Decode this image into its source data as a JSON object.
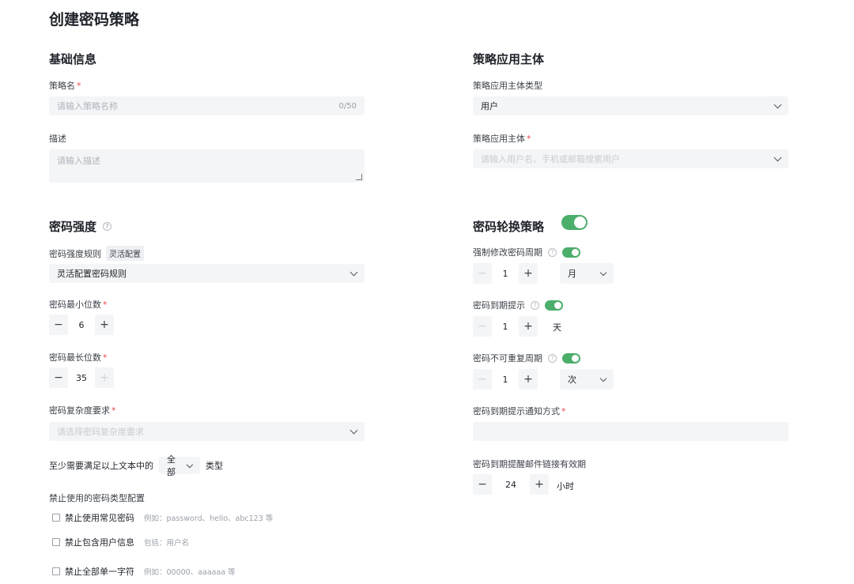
{
  "page": {
    "title": "创建密码策略",
    "breadcrumb_fragment": "……"
  },
  "basic": {
    "title": "基础信息",
    "name_label": "策略名",
    "required_mark": "*",
    "name_placeholder": "请输入策略名称",
    "name_counter": "0/50",
    "desc_label": "描述",
    "desc_placeholder": "请输入描述"
  },
  "subject": {
    "title": "策略应用主体",
    "type_label": "策略应用主体类型",
    "type_value": "用户",
    "subject_label": "策略应用主体",
    "subject_placeholder": "请输入用户名、手机或邮箱搜索用户"
  },
  "strength": {
    "title": "密码强度",
    "help_icon": "?",
    "rule_label": "密码强度规则",
    "rule_tag": "灵活配置",
    "rule_value": "灵活配置密码规则",
    "min_label": "密码最小位数",
    "min_value": "6",
    "max_label": "密码最长位数",
    "max_value": "35",
    "complexity_label": "密码复杂度要求",
    "complexity_placeholder": "请选择密码复杂度要求",
    "atleast_prefix": "至少需要满足以上文本中的",
    "atleast_value": "全部",
    "atleast_suffix": "类型",
    "forbid_title": "禁止使用的密码类型配置",
    "forbid": [
      {
        "label": "禁止使用常见密码",
        "hint": "例如：password、hello、abc123 等"
      },
      {
        "label": "禁止包含用户信息",
        "hint": "包括：用户名"
      },
      {
        "label": "禁止全部单一字符",
        "hint": "例如：00000、aaaaaa 等"
      }
    ]
  },
  "rotation": {
    "title": "密码轮换策略",
    "enabled": true,
    "force_label": "强制修改密码周期",
    "force_value": "1",
    "force_unit": "月",
    "expire_label": "密码到期提示",
    "expire_value": "1",
    "expire_unit": "天",
    "norepeat_label": "密码不可重复周期",
    "norepeat_value": "1",
    "norepeat_unit": "次",
    "notify_label": "密码到期提示通知方式",
    "link_label": "密码到期提醒邮件链接有效期",
    "link_value": "24",
    "link_unit": "小时"
  },
  "stepper": {
    "minus": "−",
    "plus": "+"
  },
  "colors": {
    "accent_green": "#4cae6b",
    "required_red": "#e5484d",
    "input_bg": "#f4f5f7"
  }
}
